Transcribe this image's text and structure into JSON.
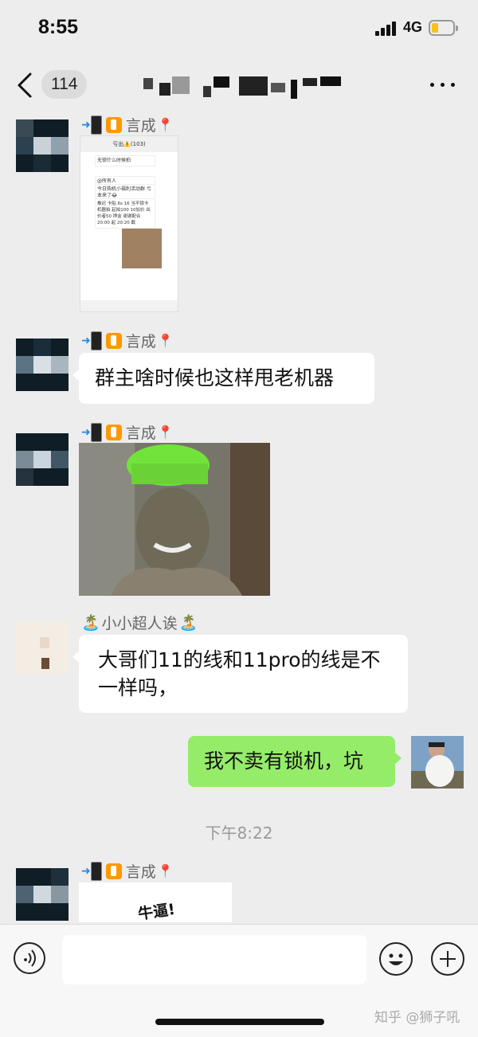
{
  "status_bar": {
    "time": "8:55",
    "network": "4G",
    "battery_level": 0.3
  },
  "nav": {
    "unread_count": "114"
  },
  "messages": [
    {
      "sender": "言成",
      "type": "screenshot",
      "screenshot": {
        "title": "亏出⚠️(103)",
        "line1": "无锁什么时候拍",
        "line2": "@所有人",
        "line3": "今日购机小福利活动群 亏本来了😂",
        "line4": "推迟 卡贴 6s 16 当不锁卡 机器拍 起拍100 10加价 出价者50 押金 谢谢配合 20:00 起 20:20 截"
      }
    },
    {
      "sender": "言成",
      "type": "text",
      "text": "群主啥时候也这样甩老机器"
    },
    {
      "sender": "言成",
      "type": "image"
    },
    {
      "sender": "小小超人诶",
      "sender_emoji": "🏝️",
      "type": "text",
      "lines": [
        "大哥们11的线和11pro的线是不",
        "一样吗，"
      ]
    },
    {
      "sender": "me",
      "type": "text",
      "text": "我不卖有锁机，坑"
    },
    {
      "sender": "言成",
      "type": "sticker",
      "sticker_text": "牛逼!"
    }
  ],
  "timestamp": "下午8:22",
  "watermark": "知乎 @狮子吼"
}
